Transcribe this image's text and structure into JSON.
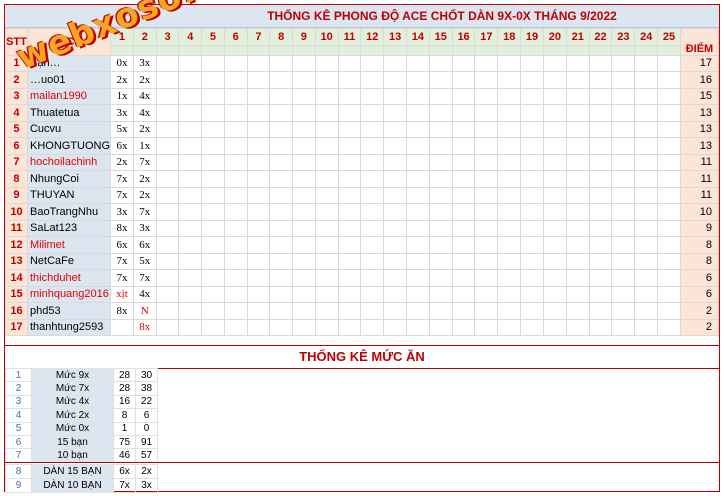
{
  "title": "THỐNG KÊ PHONG ĐỘ ACE CHỐT DÀN 9X-0X THÁNG 9/2022",
  "headers": {
    "stt": "STT",
    "nick": "NICK",
    "diem": "ĐIỂM"
  },
  "days": [
    "1",
    "2",
    "3",
    "4",
    "5",
    "6",
    "7",
    "8",
    "9",
    "10",
    "11",
    "12",
    "13",
    "14",
    "15",
    "16",
    "17",
    "18",
    "19",
    "20",
    "21",
    "22",
    "23",
    "24",
    "25"
  ],
  "rows": [
    {
      "stt": "1",
      "nick": "Bạn…",
      "d1": "0x",
      "d2": "3x",
      "diem": "17",
      "red": false
    },
    {
      "stt": "2",
      "nick": "…uo01",
      "d1": "2x",
      "d2": "2x",
      "diem": "16",
      "red": false
    },
    {
      "stt": "3",
      "nick": "mailan1990",
      "d1": "1x",
      "d2": "4x",
      "diem": "15",
      "red": true
    },
    {
      "stt": "4",
      "nick": "Thuatetua",
      "d1": "3x",
      "d2": "4x",
      "diem": "13",
      "red": false
    },
    {
      "stt": "5",
      "nick": "Cucvu",
      "d1": "5x",
      "d2": "2x",
      "diem": "13",
      "red": false
    },
    {
      "stt": "6",
      "nick": "KHONGTUONG",
      "d1": "6x",
      "d2": "1x",
      "diem": "13",
      "red": false
    },
    {
      "stt": "7",
      "nick": "hochoilachinh",
      "d1": "2x",
      "d2": "7x",
      "diem": "11",
      "red": true
    },
    {
      "stt": "8",
      "nick": "NhungCoi",
      "d1": "7x",
      "d2": "2x",
      "diem": "11",
      "red": false
    },
    {
      "stt": "9",
      "nick": "THUYAN",
      "d1": "7x",
      "d2": "2x",
      "diem": "11",
      "red": false
    },
    {
      "stt": "10",
      "nick": "BaoTrangNhu",
      "d1": "3x",
      "d2": "7x",
      "diem": "10",
      "red": false
    },
    {
      "stt": "11",
      "nick": "SaLat123",
      "d1": "8x",
      "d2": "3x",
      "diem": "9",
      "red": false
    },
    {
      "stt": "12",
      "nick": "Milimet",
      "d1": "6x",
      "d2": "6x",
      "diem": "8",
      "red": true
    },
    {
      "stt": "13",
      "nick": "NetCaFe",
      "d1": "7x",
      "d2": "5x",
      "diem": "8",
      "red": false
    },
    {
      "stt": "14",
      "nick": "thichduhet",
      "d1": "7x",
      "d2": "7x",
      "diem": "6",
      "red": true
    },
    {
      "stt": "15",
      "nick": "minhquang2016",
      "d1": "xịt",
      "d2": "4x",
      "diem": "6",
      "red": true,
      "d1red": true
    },
    {
      "stt": "16",
      "nick": "phd53",
      "d1": "8x",
      "d2": "N",
      "diem": "2",
      "red": false,
      "d2red": true
    },
    {
      "stt": "17",
      "nick": "thanhtung2593",
      "d1": "",
      "d2": "8x",
      "diem": "2",
      "red": false,
      "d2red": true
    }
  ],
  "stats_title": "THỐNG KÊ MỨC ĂN",
  "stats": [
    {
      "idx": "1",
      "label": "Mức 9x",
      "a": "28",
      "b": "30"
    },
    {
      "idx": "2",
      "label": "Mức 7x",
      "a": "28",
      "b": "38"
    },
    {
      "idx": "3",
      "label": "Mức 4x",
      "a": "16",
      "b": "22"
    },
    {
      "idx": "4",
      "label": "Mức 2x",
      "a": "8",
      "b": "6"
    },
    {
      "idx": "5",
      "label": "Mức 0x",
      "a": "1",
      "b": "0"
    },
    {
      "idx": "6",
      "label": "15 bạn",
      "a": "75",
      "b": "91"
    },
    {
      "idx": "7",
      "label": "10 bạn",
      "a": "46",
      "b": "57"
    }
  ],
  "dan": [
    {
      "idx": "8",
      "label": "DÀN 15 BẠN",
      "a": "6x",
      "b": "2x"
    },
    {
      "idx": "9",
      "label": "DÀN 10 BẠN",
      "a": "7x",
      "b": "3x"
    }
  ],
  "watermark": "webxoso.net"
}
